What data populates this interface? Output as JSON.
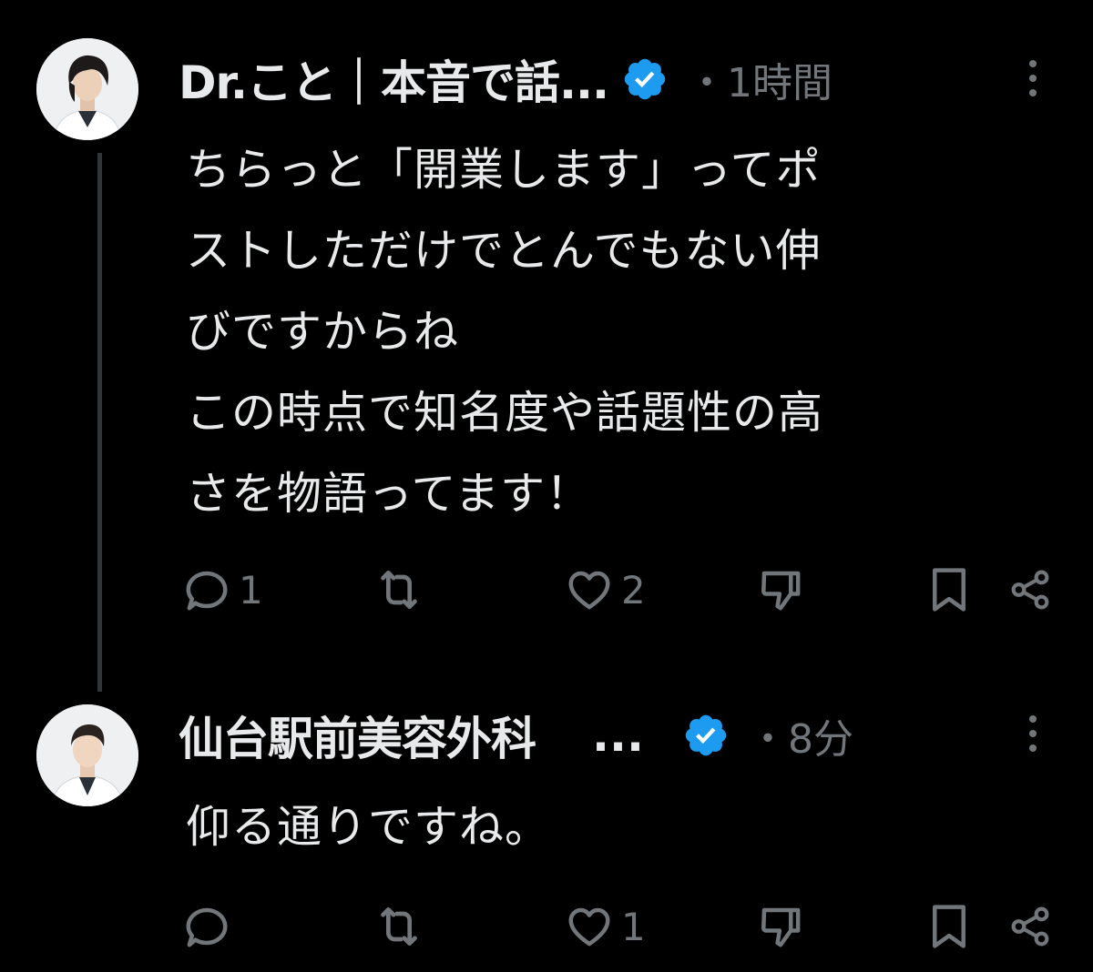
{
  "colors": {
    "background": "#000000",
    "text_primary": "#e7e9ea",
    "text_secondary": "#71767b",
    "verified_blue": "#1d9bf0",
    "thread_line": "#333639"
  },
  "posts": [
    {
      "author_name": "Dr.こと｜本音で話...",
      "verified": true,
      "time": "・1時間",
      "text": "ちらっと「開業します」ってポ\nストしただけでとんでもない伸\nびですからね\nこの時点で知名度や話題性の高\nさを物語ってます！",
      "actions": {
        "reply_count": "1",
        "repost_count": "",
        "like_count": "2"
      },
      "icons": [
        "avatar",
        "verified-badge-icon",
        "more-icon",
        "reply-icon",
        "repost-icon",
        "like-icon",
        "dislike-icon",
        "bookmark-icon",
        "share-icon"
      ]
    },
    {
      "author_name": "仙台駅前美容外科",
      "author_ellipsis": "...",
      "verified": true,
      "time": "・8分",
      "text": "仰る通りですね。",
      "actions": {
        "reply_count": "",
        "repost_count": "",
        "like_count": "1"
      },
      "icons": [
        "avatar",
        "verified-badge-icon",
        "more-icon",
        "reply-icon",
        "repost-icon",
        "like-icon",
        "dislike-icon",
        "bookmark-icon",
        "share-icon"
      ]
    }
  ]
}
